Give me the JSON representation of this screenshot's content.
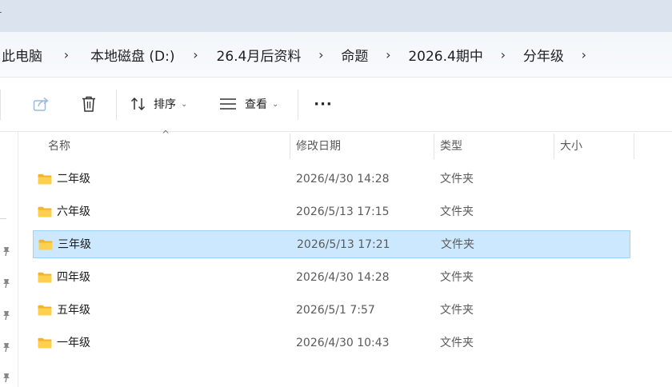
{
  "titlebar": {
    "partial_mark": "-"
  },
  "breadcrumb": {
    "items": [
      {
        "label": "此电脑"
      },
      {
        "label": "本地磁盘 (D:)"
      },
      {
        "label": "26.4月后资料"
      },
      {
        "label": "命题"
      },
      {
        "label": "2026.4期中"
      },
      {
        "label": "分年级"
      }
    ],
    "separator": "›"
  },
  "toolbar": {
    "sort_label": "排序",
    "view_label": "查看",
    "more_label": "···",
    "icons": [
      "share-icon",
      "delete-icon",
      "sort-icon",
      "view-icon",
      "more-icon"
    ]
  },
  "columns": {
    "name": "名称",
    "modified": "修改日期",
    "type": "类型",
    "size": "大小",
    "sort_indicator": "^"
  },
  "files": [
    {
      "name": "二年级",
      "modified": "2026/4/30 14:28",
      "type": "文件夹",
      "selected": false
    },
    {
      "name": "六年级",
      "modified": "2026/5/13 17:15",
      "type": "文件夹",
      "selected": false
    },
    {
      "name": "三年级",
      "modified": "2026/5/13 17:21",
      "type": "文件夹",
      "selected": true
    },
    {
      "name": "四年级",
      "modified": "2026/4/30 14:28",
      "type": "文件夹",
      "selected": false
    },
    {
      "name": "五年级",
      "modified": "2026/5/1 7:57",
      "type": "文件夹",
      "selected": false
    },
    {
      "name": "一年级",
      "modified": "2026/4/30 10:43",
      "type": "文件夹",
      "selected": false
    }
  ],
  "colors": {
    "selection_fill": "#cce8ff",
    "selection_border": "#99d1ff",
    "folder_yellow": "#f7c948",
    "titlebar": "#dae3ee"
  }
}
